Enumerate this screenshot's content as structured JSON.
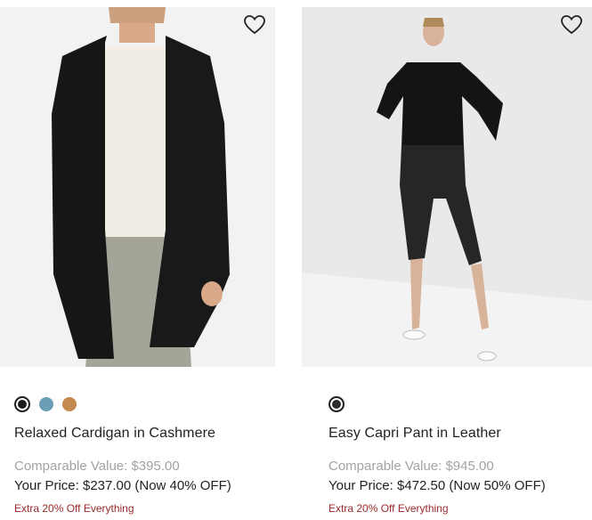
{
  "products": [
    {
      "name": "Relaxed Cardigan in Cashmere",
      "comparable_value": "Comparable Value: $395.00",
      "your_price": "Your Price: $237.00 (Now 40% OFF)",
      "promo": "Extra 20% Off Everything",
      "wishlist_icon": "heart-outline-icon",
      "swatches": [
        {
          "color": "#1a1a1a",
          "selected": true
        },
        {
          "color": "#6a9fb5",
          "selected": false
        },
        {
          "color": "#c38a4f",
          "selected": false
        }
      ]
    },
    {
      "name": "Easy Capri Pant in Leather",
      "comparable_value": "Comparable Value: $945.00",
      "your_price": "Your Price: $472.50 (Now 50% OFF)",
      "promo": "Extra 20% Off Everything",
      "wishlist_icon": "heart-outline-icon",
      "swatches": [
        {
          "color": "#2b2b2b",
          "selected": true
        }
      ]
    }
  ]
}
